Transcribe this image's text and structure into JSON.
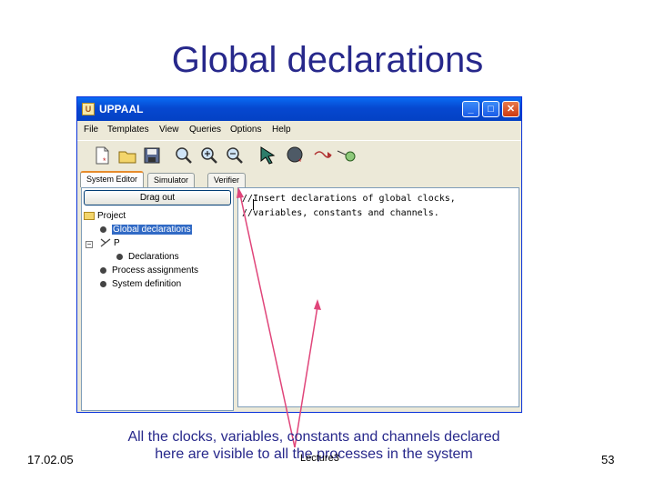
{
  "slide": {
    "title": "Global declarations",
    "note_line1": "All the clocks, variables, constants and channels declared",
    "note_line2": "here are visible to all the processes in the system",
    "date": "17.02.05",
    "lecture": "Lecture3",
    "page_number": "53"
  },
  "window": {
    "title": "UPPAAL",
    "app_icon_glyph": "U",
    "minimize_glyph": "_",
    "maximize_glyph": "□",
    "close_glyph": "✕"
  },
  "menu": {
    "items": [
      "File",
      "Templates",
      "View",
      "Queries",
      "Options",
      "Help"
    ]
  },
  "toolbar": {
    "icons": [
      "new-document-icon",
      "open-folder-icon",
      "save-disk-icon",
      "zoom-icon",
      "zoom-in-icon",
      "zoom-out-icon",
      "select-arrow-icon",
      "add-location-icon",
      "add-edge-icon",
      "add-nail-icon"
    ]
  },
  "tabs": {
    "items": [
      "System Editor",
      "Simulator",
      "Verifier"
    ]
  },
  "project_tree": {
    "drag_out_label": "Drag out",
    "root": "Project",
    "global_declarations": "Global declarations",
    "template_p": "P",
    "declarations": "Declarations",
    "process_assignments": "Process assignments",
    "system_definition": "System definition",
    "collapse_glyph": "−"
  },
  "editor": {
    "lines": [
      "//Insert declarations of global clocks,",
      "//variables, constants and channels."
    ]
  },
  "colors": {
    "title_blue": "#27288b",
    "arrow_red": "#e0457a",
    "selection_blue": "#316ac5"
  }
}
